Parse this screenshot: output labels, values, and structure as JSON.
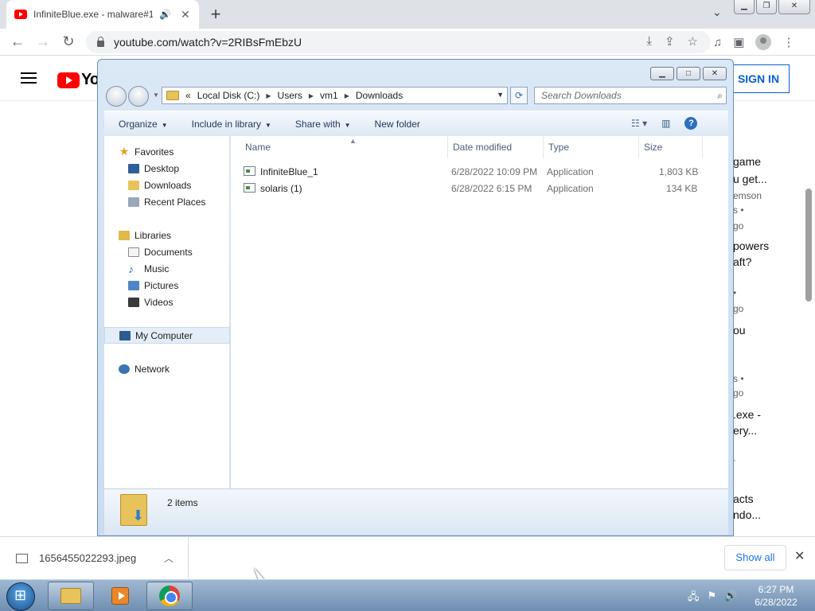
{
  "browser": {
    "tab_title": "InfiniteBlue.exe - malware#1",
    "url": "youtube.com/watch?v=2RIBsFmEbzU",
    "new_tab_symbol": "+",
    "tab_close_symbol": "✕"
  },
  "youtube": {
    "logo_text": "Yo",
    "signin_label": "SIGN IN",
    "sidebar_fragments": [
      {
        "text": "game",
        "meta": false
      },
      {
        "text": "u get...",
        "meta": false
      },
      {
        "text": "emson",
        "meta": true
      },
      {
        "text": "s •",
        "meta": true
      },
      {
        "text": "go",
        "meta": true
      },
      {
        "text": "powers",
        "meta": false
      },
      {
        "text": "aft?",
        "meta": false
      },
      {
        "text": "•",
        "meta": true
      },
      {
        "text": "go",
        "meta": true
      },
      {
        "text": "ou",
        "meta": false
      },
      {
        "text": "s •",
        "meta": true
      },
      {
        "text": "go",
        "meta": true
      },
      {
        "text": ".exe -",
        "meta": false
      },
      {
        "text": "ery...",
        "meta": false
      },
      {
        "text": "·",
        "meta": true
      },
      {
        "text": "acts",
        "meta": false
      },
      {
        "text": "ndo...",
        "meta": false
      }
    ]
  },
  "explorer": {
    "breadcrumb_prefix": "«",
    "breadcrumbs": [
      "Local Disk (C:)",
      "Users",
      "vm1",
      "Downloads"
    ],
    "search_placeholder": "Search Downloads",
    "commands": [
      "Organize",
      "Include in library",
      "Share with",
      "New folder"
    ],
    "nav": {
      "favorites": "Favorites",
      "favorite_items": [
        "Desktop",
        "Downloads",
        "Recent Places"
      ],
      "libraries": "Libraries",
      "library_items": [
        "Documents",
        "Music",
        "Pictures",
        "Videos"
      ],
      "computer": "My Computer",
      "network": "Network"
    },
    "columns": [
      "Name",
      "Date modified",
      "Type",
      "Size"
    ],
    "files": [
      {
        "name": "InfiniteBlue_1",
        "date": "6/28/2022 10:09 PM",
        "type": "Application",
        "size": "1,803 KB"
      },
      {
        "name": "solaris (1)",
        "date": "6/28/2022 6:15 PM",
        "type": "Application",
        "size": "134 KB"
      }
    ],
    "item_count": "2 items"
  },
  "downloads": {
    "file": "1656455022293.jpeg",
    "show_all": "Show all"
  },
  "taskbar": {
    "time": "6:27 PM",
    "date": "6/28/2022"
  },
  "colors": {
    "youtube_red": "#ff0000",
    "signin_blue": "#065fd4",
    "explorer_frame": "#c9dcf1"
  }
}
